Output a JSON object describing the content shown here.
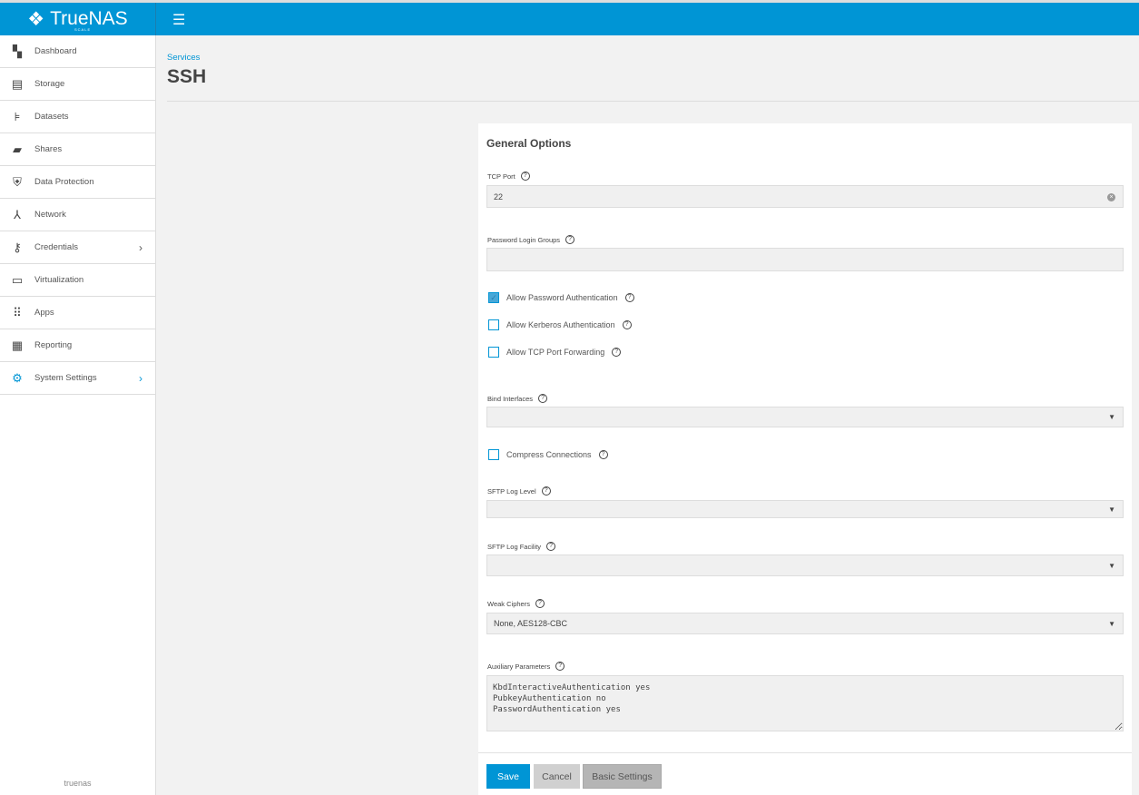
{
  "header": {
    "brand": "TrueNAS",
    "brand_sub": "SCALE"
  },
  "sidebar": {
    "items": [
      {
        "label": "Dashboard",
        "icon": "dashboard-icon"
      },
      {
        "label": "Storage",
        "icon": "storage-icon"
      },
      {
        "label": "Datasets",
        "icon": "datasets-icon"
      },
      {
        "label": "Shares",
        "icon": "shares-icon"
      },
      {
        "label": "Data Protection",
        "icon": "shield-icon"
      },
      {
        "label": "Network",
        "icon": "network-icon"
      },
      {
        "label": "Credentials",
        "icon": "key-icon"
      },
      {
        "label": "Virtualization",
        "icon": "laptop-icon"
      },
      {
        "label": "Apps",
        "icon": "apps-icon"
      },
      {
        "label": "Reporting",
        "icon": "chart-icon"
      },
      {
        "label": "System Settings",
        "icon": "gear-icon"
      }
    ],
    "hostname": "truenas"
  },
  "page": {
    "breadcrumb": "Services",
    "title": "SSH"
  },
  "form": {
    "section": "General Options",
    "tcp_port_label": "TCP Port",
    "tcp_port": "22",
    "password_groups_label": "Password Login Groups",
    "allow_password": "Allow Password Authentication",
    "allow_kerberos": "Allow Kerberos Authentication",
    "allow_tcp_fwd": "Allow TCP Port Forwarding",
    "bind_label": "Bind Interfaces",
    "compress": "Compress Connections",
    "sftp_level_label": "SFTP Log Level",
    "sftp_facility_label": "SFTP Log Facility",
    "weak_ciphers_label": "Weak Ciphers",
    "weak_ciphers": "None, AES128-CBC",
    "aux_label": "Auxiliary Parameters",
    "aux_value": "KbdInteractiveAuthentication yes\nPubkeyAuthentication no\nPasswordAuthentication yes",
    "save": "Save",
    "cancel": "Cancel",
    "basic": "Basic Settings"
  },
  "colors": {
    "accent": "#0095d5"
  }
}
